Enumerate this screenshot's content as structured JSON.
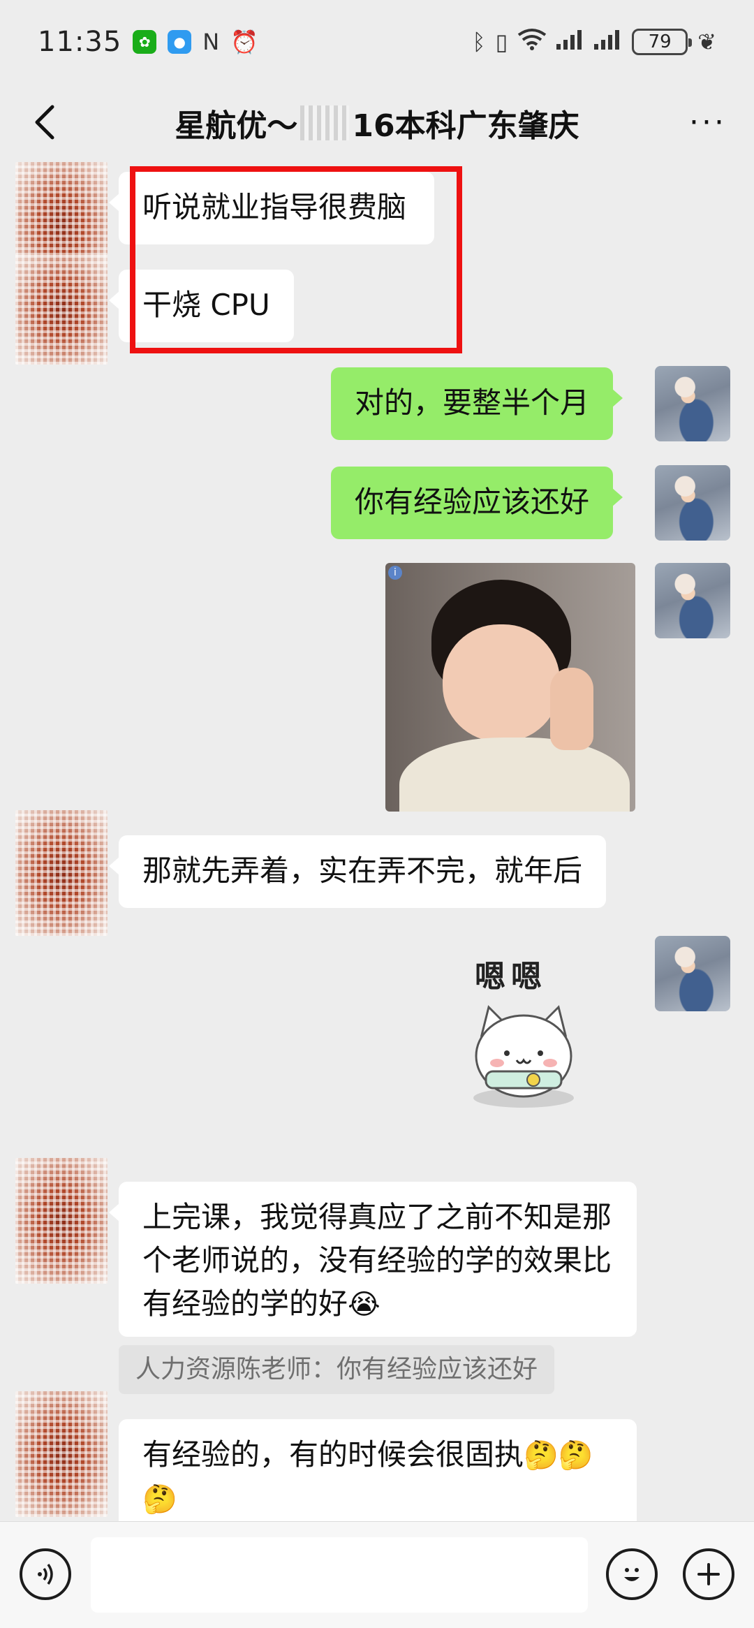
{
  "status_bar": {
    "time": "11:35",
    "battery": "79",
    "notification_icons": [
      "wechat-icon",
      "message-icon",
      "nfc-icon",
      "alarm-icon"
    ],
    "right_icons": [
      "bluetooth-icon",
      "vibrate-icon",
      "wifi-icon",
      "signal-icon",
      "signal-icon",
      "leaf-icon"
    ]
  },
  "nav": {
    "title_prefix": "星航优～",
    "title_suffix": "16本科广东肇庆",
    "more": "···"
  },
  "messages": [
    {
      "side": "left",
      "type": "text",
      "text": "听说就业指导很费脑"
    },
    {
      "side": "left",
      "type": "text",
      "text": "干烧 CPU"
    },
    {
      "side": "right",
      "type": "text",
      "text": "对的，要整半个月"
    },
    {
      "side": "right",
      "type": "text",
      "text": "你有经验应该还好"
    },
    {
      "side": "right",
      "type": "image",
      "description": "thumbs-up-child-sticker"
    },
    {
      "side": "left",
      "type": "text",
      "text": "那就先弄着，实在弄不完，就年后"
    },
    {
      "side": "right",
      "type": "sticker",
      "text": "嗯嗯"
    },
    {
      "side": "left",
      "type": "text",
      "text": "上完课，我觉得真应了之前不知是那个老师说的，没有经验的学的效果比有经验的学的好",
      "emoji": "😭"
    },
    {
      "side": "left",
      "type": "quote",
      "text": "人力资源陈老师：你有经验应该还好"
    },
    {
      "side": "left",
      "type": "text",
      "text": "有经验的，有的时候会很固执",
      "emoji": "🤔🤔🤔"
    }
  ],
  "colors": {
    "background": "#ededed",
    "bubble_self": "#95ec69",
    "bubble_other": "#ffffff",
    "highlight": "#ee1111"
  },
  "input_bar": {
    "voice_icon": "voice-icon",
    "emoji_icon": "emoji-icon",
    "plus_icon": "plus-icon",
    "value": "",
    "placeholder": ""
  }
}
